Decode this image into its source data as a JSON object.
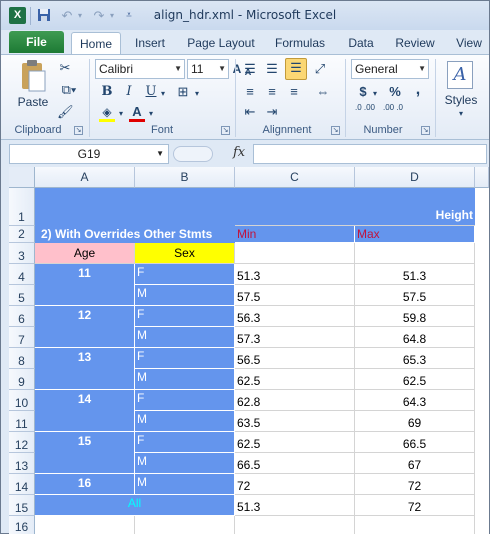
{
  "title": "align_hdr.xml - Microsoft Excel",
  "app_icon": "X",
  "qat": {
    "save_icon": "save-icon",
    "undo_icon": "undo-icon",
    "redo_icon": "redo-icon"
  },
  "tabs": [
    "File",
    "Home",
    "Insert",
    "Page Layout",
    "Formulas",
    "Data",
    "Review",
    "View"
  ],
  "ribbon": {
    "clipboard": {
      "label": "Clipboard",
      "paste": "Paste"
    },
    "font": {
      "label": "Font",
      "name": "Calibri",
      "size": "11",
      "bold": "B",
      "italic": "I",
      "underline": "U",
      "grow": "A",
      "shrink": "A"
    },
    "alignment": {
      "label": "Alignment"
    },
    "number": {
      "label": "Number",
      "format": "General",
      "currency": "$",
      "percent": "%",
      "comma": ",",
      "inc": ".0 .00",
      "dec": ".00 .0"
    },
    "styles": {
      "label": "Styles"
    }
  },
  "formula_bar": {
    "name_box": "G19",
    "fx": "fx",
    "value": ""
  },
  "columns": [
    "A",
    "B",
    "C",
    "D"
  ],
  "rows": [
    "1",
    "2",
    "3",
    "4",
    "5",
    "6",
    "7",
    "8",
    "9",
    "10",
    "11",
    "12",
    "13",
    "14",
    "15",
    "16"
  ],
  "sheet": {
    "row1_height": "Height",
    "row2_title": "2) With Overrides Other Stmts",
    "row2_min": "Min",
    "row2_max": "Max",
    "hdr_age": "Age",
    "hdr_sex": "Sex",
    "ages": [
      "11",
      "12",
      "13",
      "14",
      "15",
      "16"
    ],
    "sexes": [
      "F",
      "M",
      "F",
      "M",
      "F",
      "M",
      "F",
      "M",
      "F",
      "M",
      "M"
    ],
    "all_label": "All",
    "min_vals": [
      "51.3",
      "57.5",
      "56.3",
      "57.3",
      "56.5",
      "62.5",
      "62.8",
      "63.5",
      "62.5",
      "66.5",
      "72",
      "51.3"
    ],
    "max_vals": [
      "51.3",
      "57.5",
      "59.8",
      "64.8",
      "65.3",
      "62.5",
      "64.3",
      "69",
      "66.5",
      "67",
      "72",
      "72"
    ]
  },
  "colors": {
    "header_blue": "#6495ED",
    "age_pink": "#FFC0CB",
    "sex_yellow": "#FFFF00",
    "minmax_red": "#C0143C",
    "all_cyan": "#00FFFF"
  }
}
